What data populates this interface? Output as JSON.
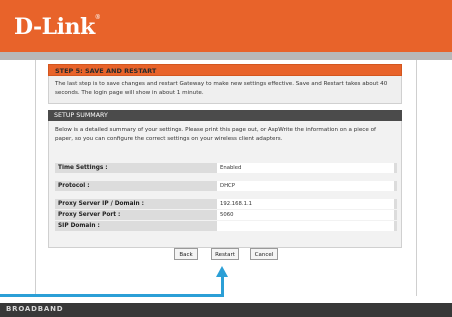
{
  "header": {
    "logo": "D-Link",
    "logo_tm": "®"
  },
  "step": {
    "title": "STEP 5: SAVE AND RESTART",
    "text": "The last step is to save changes and restart Gateway to make new settings effective. Save and Restart takes about 40 seconds. The login page will show in about 1 minute."
  },
  "summary": {
    "title": "SETUP SUMMARY",
    "text": "Below is a detailed summary of your settings. Please print this page out, or AspWrite the information on a piece of paper, so you can configure the correct settings on your wireless client adapters.",
    "rows": [
      {
        "label": "Time Settings :",
        "value": "Enabled"
      },
      {
        "label": "Protocol :",
        "value": "DHCP"
      },
      {
        "label": "Proxy Server IP / Domain :",
        "value": "192.168.1.1"
      },
      {
        "label": "Proxy Server Port :",
        "value": "5060"
      },
      {
        "label": "SIP Domain :",
        "value": ""
      }
    ]
  },
  "buttons": {
    "back": "Back",
    "restart": "Restart",
    "cancel": "Cancel"
  },
  "footer": {
    "text": "BROADBAND"
  },
  "colors": {
    "brand": "#e8632a",
    "section_header": "#4b4b4b",
    "arrow": "#2b9fd6",
    "footer": "#383838"
  }
}
